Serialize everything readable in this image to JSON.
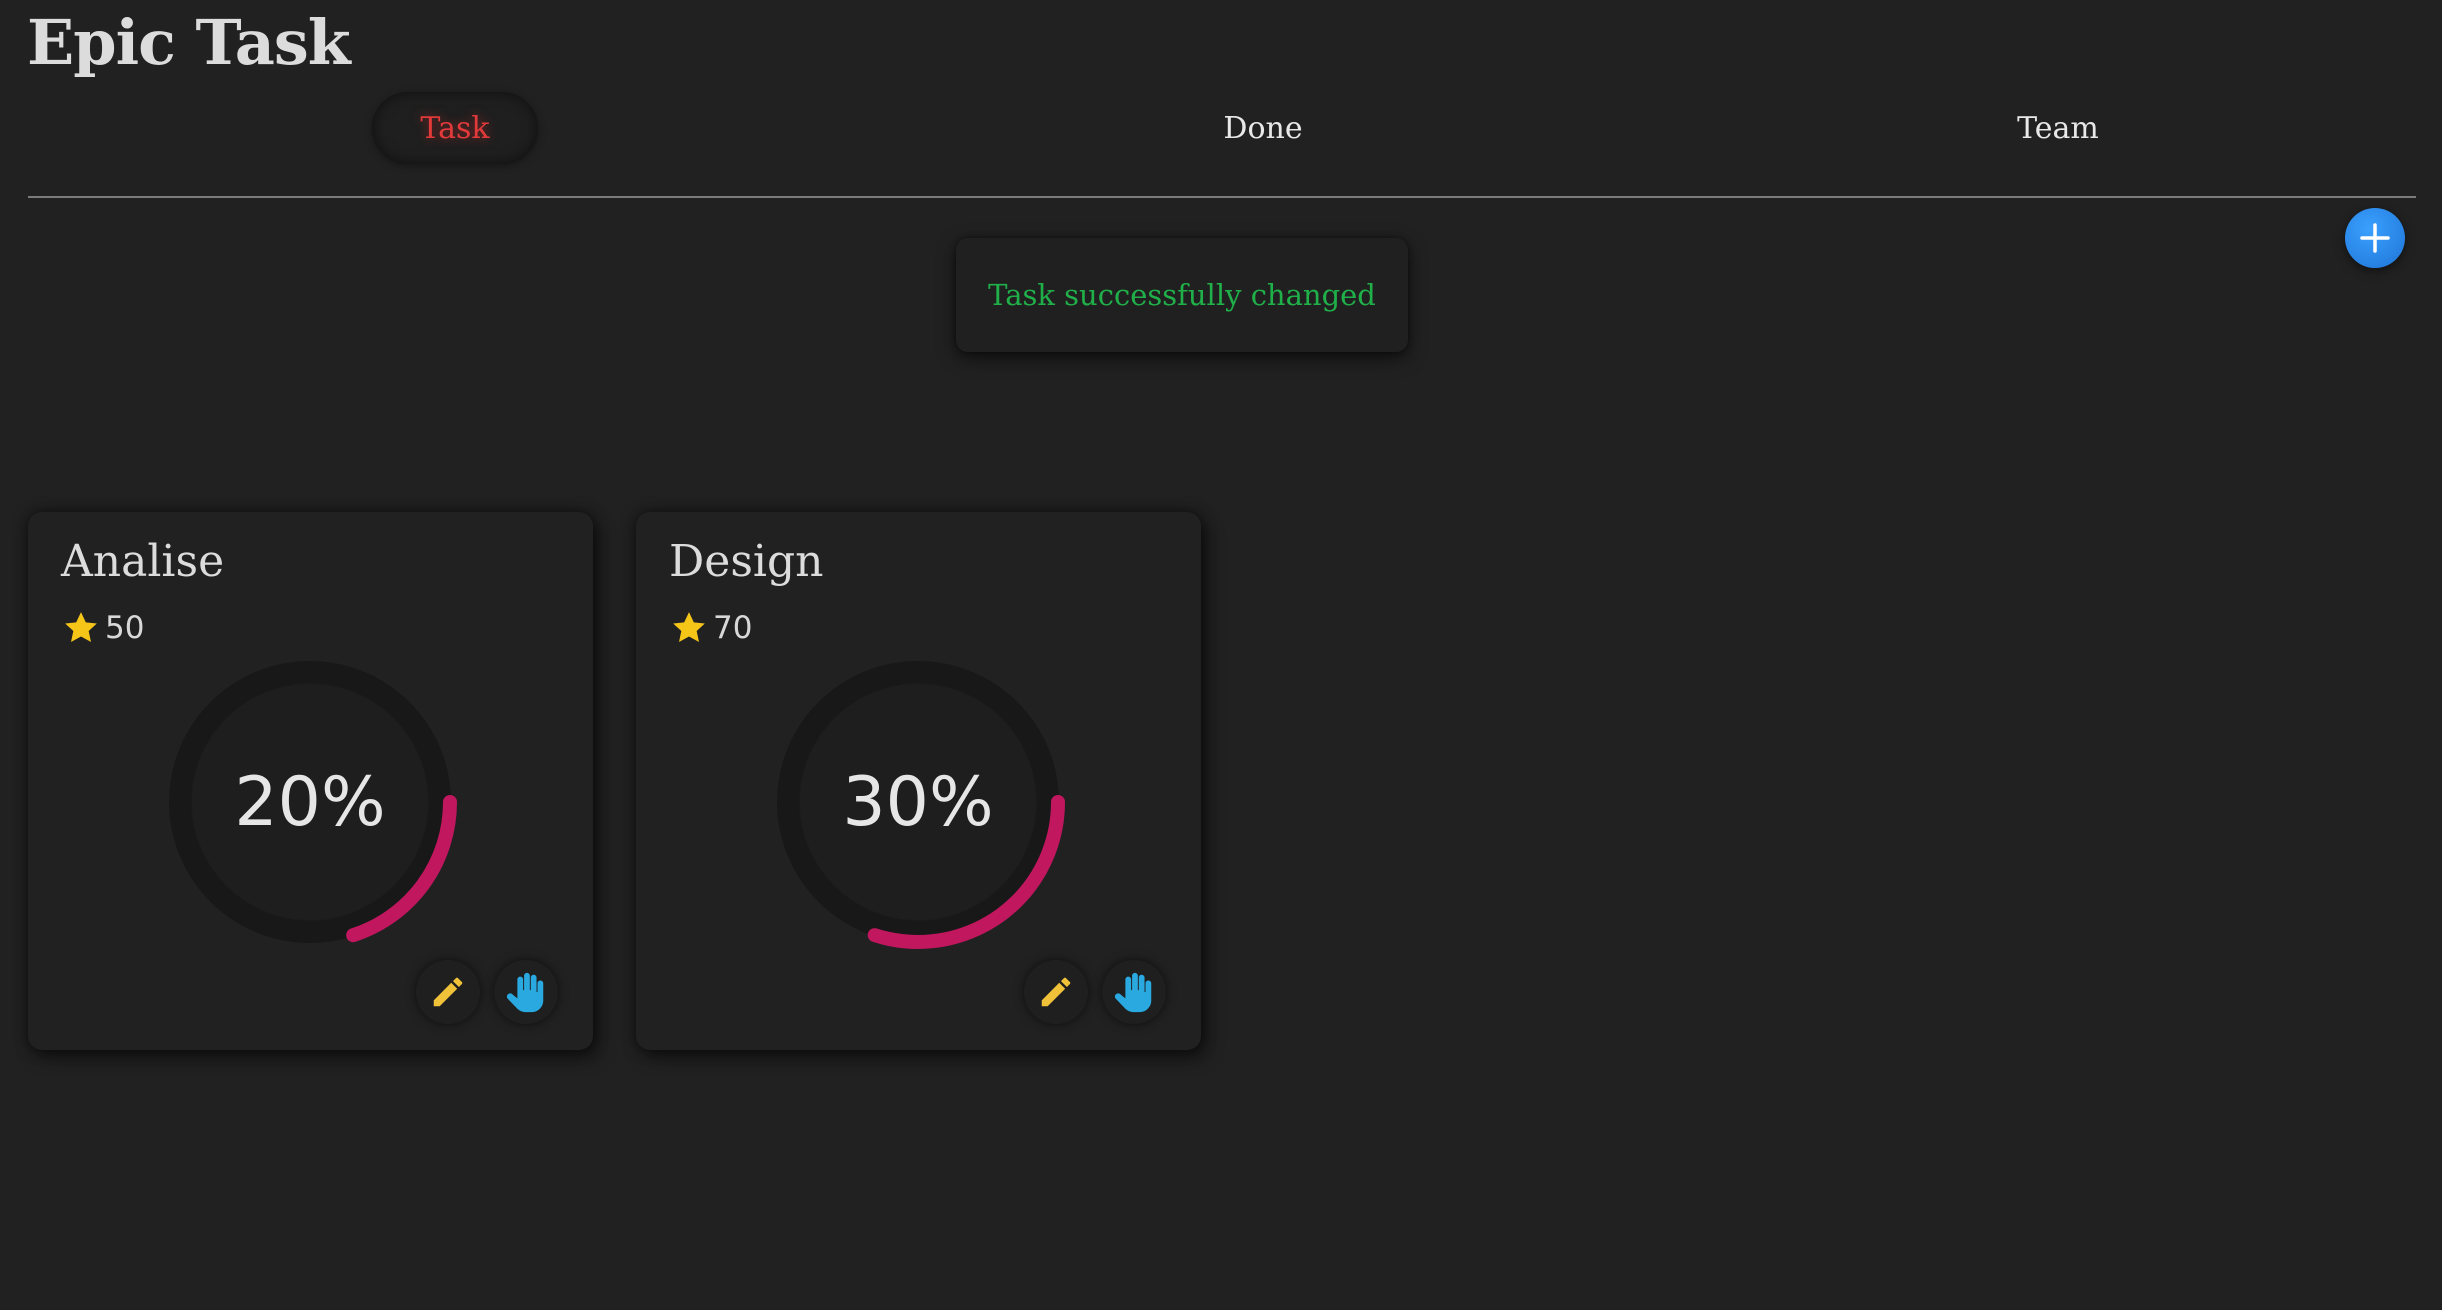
{
  "app": {
    "title": "Epic Task"
  },
  "nav": {
    "tabs": [
      {
        "label": "Task",
        "active": true
      },
      {
        "label": "Done",
        "active": false
      },
      {
        "label": "Team",
        "active": false
      }
    ]
  },
  "add_button": {
    "icon": "plus-icon"
  },
  "toast": {
    "message": "Task successfully changed",
    "color": "#20b04a"
  },
  "tasks": [
    {
      "title": "Analise",
      "points": "50",
      "progress": 20,
      "progress_label": "20%"
    },
    {
      "title": "Design",
      "points": "70",
      "progress": 30,
      "progress_label": "30%"
    }
  ],
  "icons": {
    "points": "star-icon",
    "edit": "pencil-icon",
    "raise": "hand-icon"
  },
  "colors": {
    "background": "#212121",
    "active_tab": "#e23a3a",
    "progress_ring": "#c0175f",
    "add_button": "#2a8cf0",
    "star": "#f5c518",
    "pencil": "#f0c23a",
    "hand": "#2aa8e0"
  }
}
